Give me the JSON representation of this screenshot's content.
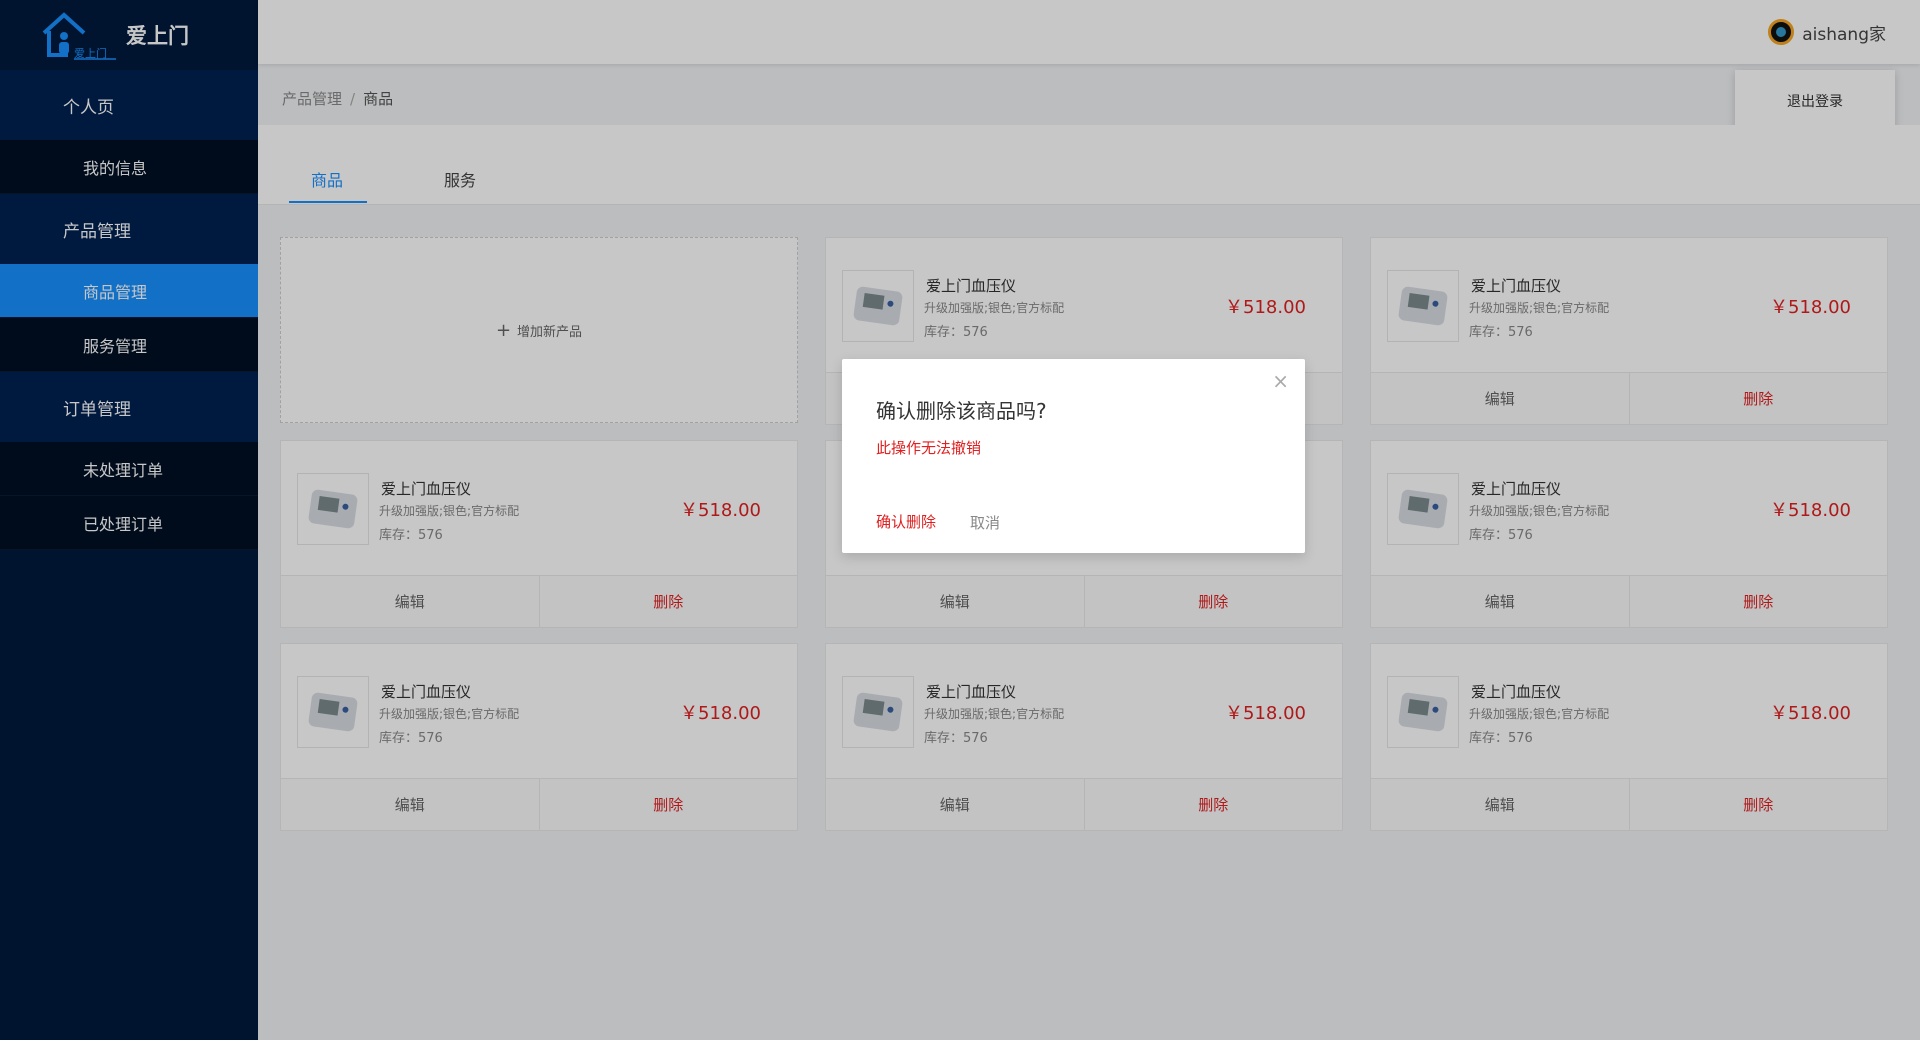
{
  "app": {
    "name": "爱上门",
    "logo_sub": "爱上门"
  },
  "sidebar": {
    "groups": [
      {
        "label": "个人页",
        "items": [
          {
            "label": "我的信息"
          }
        ]
      },
      {
        "label": "产品管理",
        "items": [
          {
            "label": "商品管理"
          },
          {
            "label": "服务管理"
          }
        ]
      },
      {
        "label": "订单管理",
        "items": [
          {
            "label": "未处理订单"
          },
          {
            "label": "已处理订单"
          }
        ]
      }
    ],
    "active_item": "商品管理"
  },
  "header": {
    "username": "aishang家",
    "logout_label": "退出登录"
  },
  "breadcrumb": {
    "parent": "产品管理",
    "separator": "/",
    "current": "商品"
  },
  "tabs": [
    {
      "label": "商品",
      "active": true
    },
    {
      "label": "服务",
      "active": false
    }
  ],
  "add_product": {
    "label": "增加新产品",
    "plus": "+"
  },
  "products": [
    {
      "name": "爱上门血压仪",
      "desc": "升级加强版;银色;官方标配",
      "stock": "库存：576",
      "price": "￥518.00",
      "edit": "编辑",
      "delete": "删除"
    },
    {
      "name": "爱上门血压仪",
      "desc": "升级加强版;银色;官方标配",
      "stock": "库存：576",
      "price": "￥518.00",
      "edit": "编辑",
      "delete": "删除"
    },
    {
      "name": "爱上门血压仪",
      "desc": "升级加强版;银色;官方标配",
      "stock": "库存：576",
      "price": "￥518.00",
      "edit": "编辑",
      "delete": "删除"
    },
    {
      "name": "爱上门血压仪",
      "desc": "升级加强版;银色;官方标配",
      "stock": "库存：576",
      "price": "￥518.00",
      "edit": "编辑",
      "delete": "删除"
    },
    {
      "name": "爱上门血压仪",
      "desc": "升级加强版;银色;官方标配",
      "stock": "库存：576",
      "price": "￥518.00",
      "edit": "编辑",
      "delete": "删除"
    },
    {
      "name": "爱上门血压仪",
      "desc": "升级加强版;银色;官方标配",
      "stock": "库存：576",
      "price": "￥518.00",
      "edit": "编辑",
      "delete": "删除"
    },
    {
      "name": "爱上门血压仪",
      "desc": "升级加强版;银色;官方标配",
      "stock": "库存：576",
      "price": "￥518.00",
      "edit": "编辑",
      "delete": "删除"
    },
    {
      "name": "爱上门血压仪",
      "desc": "升级加强版;银色;官方标配",
      "stock": "库存：576",
      "price": "￥518.00",
      "edit": "编辑",
      "delete": "删除"
    }
  ],
  "modal": {
    "title": "确认删除该商品吗?",
    "warning": "此操作无法撤销",
    "confirm": "确认删除",
    "cancel": "取消",
    "close": "×"
  },
  "colors": {
    "sidebar_bg": "#001a3d",
    "active": "#1890ff",
    "danger": "#e02020"
  }
}
